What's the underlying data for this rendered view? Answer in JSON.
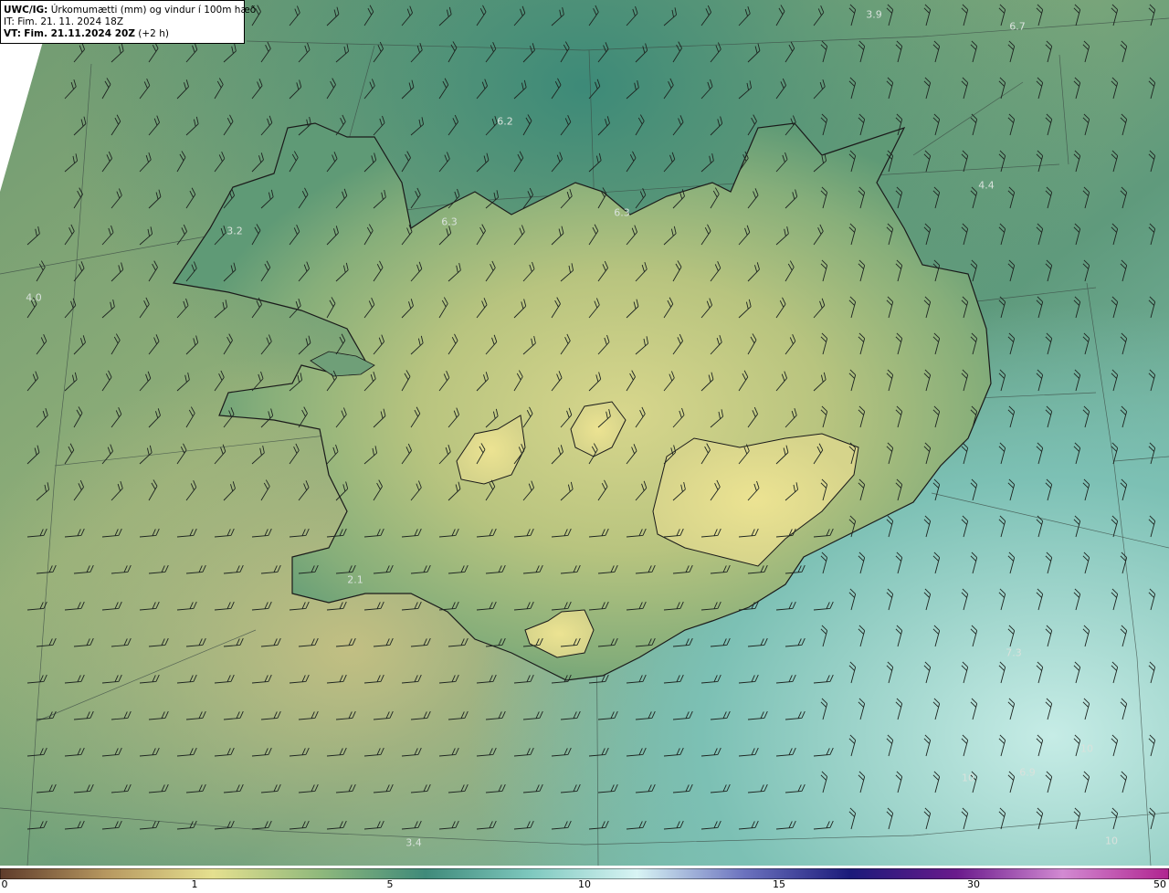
{
  "header": {
    "model": "UWC/IG:",
    "product": "Úrkomumætti (mm) og vindur í 100m hæð",
    "init_time": "IT: Fim. 21. 11. 2024 18Z",
    "valid_prefix": "VT:",
    "valid_time": "Fim. 21.11.2024 20Z",
    "lead_time": "(+2 h)"
  },
  "map_labels": [
    {
      "text": "3.9"
    },
    {
      "text": "6.7"
    },
    {
      "text": "6.2"
    },
    {
      "text": "4.4"
    },
    {
      "text": "6.3"
    },
    {
      "text": "6.3"
    },
    {
      "text": "3.2"
    },
    {
      "text": "4.0"
    },
    {
      "text": "2.1"
    },
    {
      "text": "3.4"
    },
    {
      "text": "7.3"
    },
    {
      "text": "10"
    },
    {
      "text": "10"
    },
    {
      "text": "6.9"
    },
    {
      "text": "10"
    }
  ],
  "colorbar": {
    "colors": [
      "#5e3b2a",
      "#b79860",
      "#e5e08f",
      "#90b97c",
      "#3f8a7a",
      "#7fc9bf",
      "#d8f4f4",
      "#6c73bf",
      "#1b1a7a",
      "#6a1a8c",
      "#d28ad2",
      "#b0238f"
    ],
    "ticks": [
      "0",
      "1",
      "5",
      "10",
      "15",
      "30",
      "50"
    ]
  }
}
